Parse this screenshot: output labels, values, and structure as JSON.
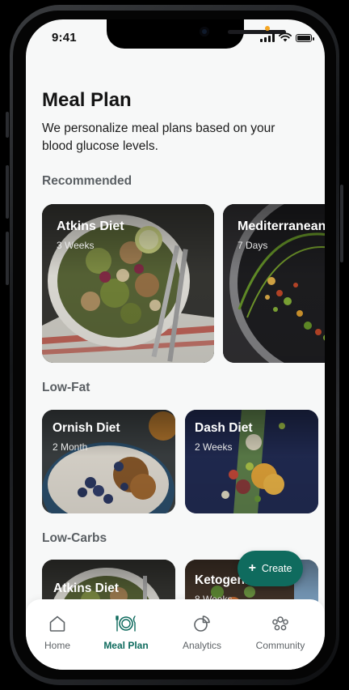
{
  "status": {
    "time": "9:41"
  },
  "page": {
    "title": "Meal Plan",
    "subtitle": "We personalize meal plans based on your blood glucose levels."
  },
  "sections": {
    "recommended": {
      "title": "Recommended",
      "cards": [
        {
          "title": "Atkins Diet",
          "duration": "3 Weeks"
        },
        {
          "title": "Mediterranean",
          "duration": "7 Days"
        }
      ]
    },
    "lowfat": {
      "title": "Low-Fat",
      "cards": [
        {
          "title": "Ornish Diet",
          "duration": "2 Month"
        },
        {
          "title": "Dash Diet",
          "duration": "2 Weeks"
        }
      ]
    },
    "lowcarbs": {
      "title": "Low-Carbs",
      "cards": [
        {
          "title": "Atkins Diet",
          "duration": ""
        },
        {
          "title": "Ketogenic",
          "duration": "8 Weeks"
        }
      ]
    }
  },
  "fab": {
    "label": "Create",
    "icon": "plus-icon"
  },
  "tabbar": {
    "items": [
      {
        "label": "Home",
        "icon": "home-icon"
      },
      {
        "label": "Meal Plan",
        "icon": "plate-icon",
        "active": true
      },
      {
        "label": "Analytics",
        "icon": "pie-chart-icon"
      },
      {
        "label": "Community",
        "icon": "community-icon"
      }
    ]
  },
  "colors": {
    "accent": "#0f6b5e",
    "background": "#f7f8f8"
  }
}
